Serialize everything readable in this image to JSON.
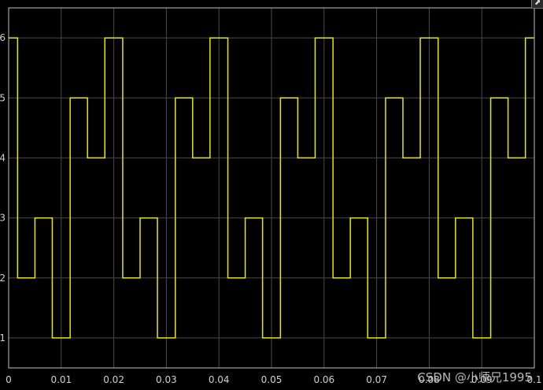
{
  "chart_data": {
    "type": "line",
    "title": "",
    "xlabel": "",
    "ylabel": "",
    "xlim": [
      0,
      0.1
    ],
    "ylim": [
      0.5,
      6.5
    ],
    "xticks": [
      "0",
      "0.01",
      "0.02",
      "0.03",
      "0.04",
      "0.05",
      "0.06",
      "0.07",
      "0.08",
      "0.09",
      "0.1"
    ],
    "yticks": [
      "1",
      "2",
      "3",
      "4",
      "5",
      "6"
    ],
    "grid": true,
    "series": [
      {
        "color": "#e8e800",
        "step": "post",
        "x": [
          0,
          0.0017,
          0.005,
          0.0083,
          0.0117,
          0.015,
          0.0183,
          0.0217,
          0.025,
          0.0283,
          0.0317,
          0.035,
          0.0383,
          0.0417,
          0.045,
          0.0483,
          0.0517,
          0.055,
          0.0583,
          0.0617,
          0.065,
          0.0683,
          0.0717,
          0.075,
          0.0783,
          0.0817,
          0.085,
          0.0883,
          0.0917,
          0.095,
          0.0983,
          0.1
        ],
        "y": [
          6,
          2,
          3,
          1,
          5,
          4,
          6,
          2,
          3,
          1,
          5,
          4,
          6,
          2,
          3,
          1,
          5,
          4,
          6,
          2,
          3,
          1,
          5,
          4,
          6,
          2,
          3,
          1,
          5,
          4,
          6,
          6
        ]
      }
    ]
  },
  "watermark": "CSDN @小师兄1995",
  "corner_glyph": "⬈"
}
